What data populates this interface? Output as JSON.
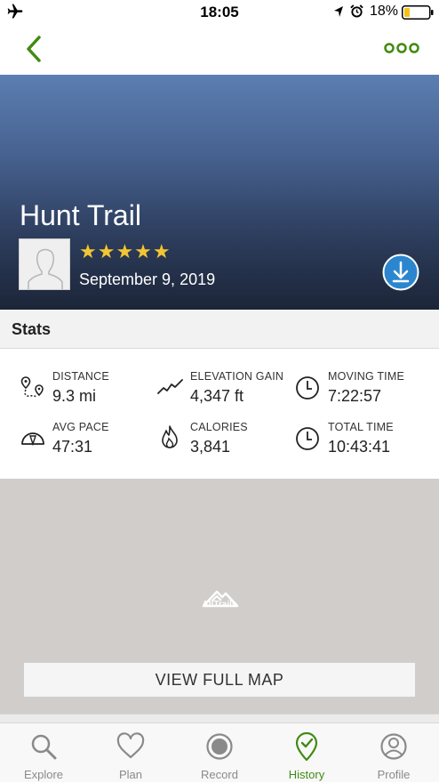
{
  "status_bar": {
    "time": "18:05",
    "battery": "18%",
    "icons": [
      "airplane-icon",
      "location-arrow-icon",
      "alarm-icon",
      "battery-icon"
    ]
  },
  "nav": {
    "back_icon": "chevron-left-icon",
    "more_icon": "more-dots-icon",
    "accent_color": "#428a13"
  },
  "trail": {
    "title": "Hunt Trail",
    "stars": "★★★★★",
    "rating": 5,
    "date": "September 9, 2019",
    "star_color": "#f3c532",
    "download_color": "#2b86cf"
  },
  "stats": {
    "title": "Stats",
    "items": [
      {
        "label": "DISTANCE",
        "value": "9.3 mi",
        "icon": "route-icon"
      },
      {
        "label": "ELEVATION GAIN",
        "value": "4,347 ft",
        "icon": "elevation-icon"
      },
      {
        "label": "MOVING TIME",
        "value": "7:22:57",
        "icon": "clock-icon"
      },
      {
        "label": "AVG PACE",
        "value": "47:31",
        "icon": "speedometer-icon"
      },
      {
        "label": "CALORIES",
        "value": "3,841",
        "icon": "flame-icon"
      },
      {
        "label": "TOTAL TIME",
        "value": "10:43:41",
        "icon": "clock-icon"
      }
    ]
  },
  "map": {
    "logo_text": "AllTrails",
    "view_full_map": "VIEW FULL MAP"
  },
  "tabs": [
    {
      "label": "Explore",
      "icon": "search-icon",
      "active": false
    },
    {
      "label": "Plan",
      "icon": "heart-icon",
      "active": false
    },
    {
      "label": "Record",
      "icon": "record-icon",
      "active": false
    },
    {
      "label": "History",
      "icon": "history-check-pin-icon",
      "active": true
    },
    {
      "label": "Profile",
      "icon": "profile-icon",
      "active": false
    }
  ]
}
